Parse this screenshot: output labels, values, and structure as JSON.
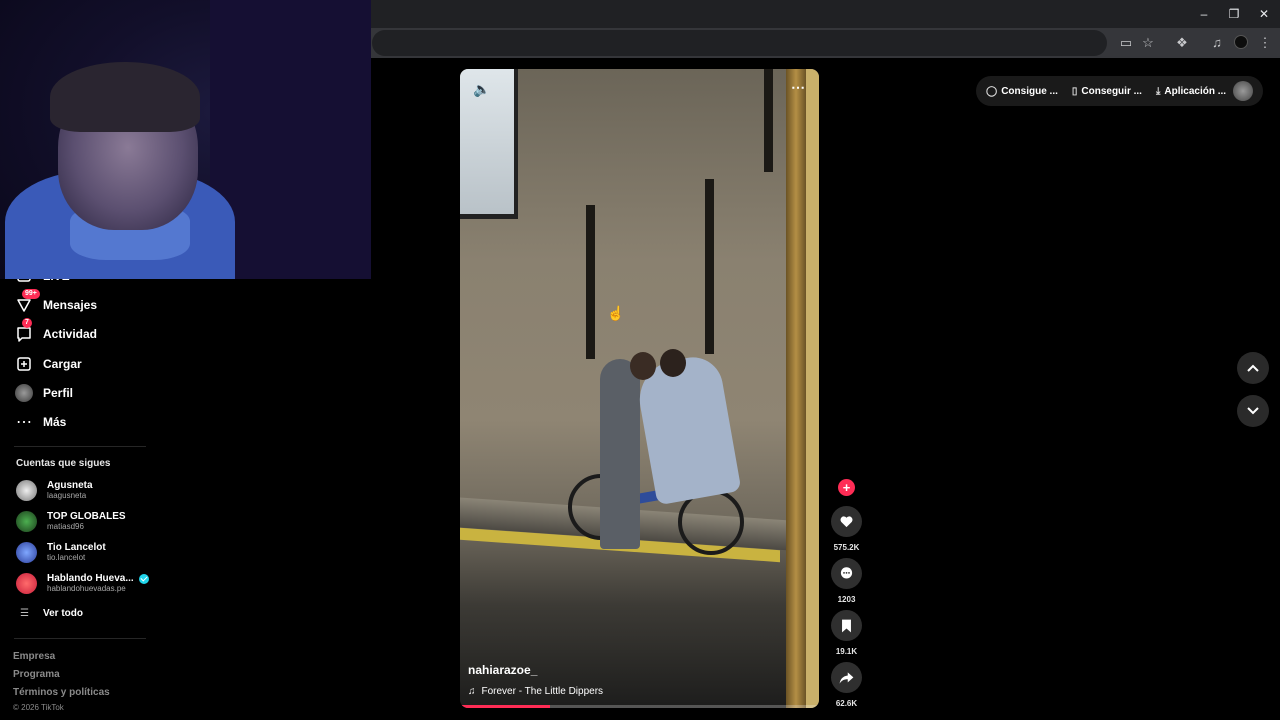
{
  "sidebar": {
    "nav": [
      {
        "label": "LIVE",
        "icon": "live-icon"
      },
      {
        "label": "Mensajes",
        "icon": "messages-icon",
        "badge": "99+"
      },
      {
        "label": "Actividad",
        "icon": "activity-icon",
        "badge": "7"
      },
      {
        "label": "Cargar",
        "icon": "upload-icon"
      },
      {
        "label": "Perfil",
        "icon": "profile-avatar"
      },
      {
        "label": "Más",
        "icon": "more-icon"
      }
    ],
    "following_title": "Cuentas que sigues",
    "accounts": [
      {
        "name": "Agusneta",
        "user": "laagusneta"
      },
      {
        "name": "TOP GLOBALES",
        "user": "matiasd96"
      },
      {
        "name": "Tio Lancelot",
        "user": "tio.lancelot"
      },
      {
        "name": "Hablando Hueva...",
        "user": "hablandohuevadas.pe",
        "verified": true
      }
    ],
    "see_all": "Ver todo",
    "footer": [
      "Empresa",
      "Programa",
      "Términos y políticas"
    ],
    "copyright": "© 2026 TikTok"
  },
  "video": {
    "author": "nahiarazoe_",
    "music": "Forever - The Little Dippers",
    "progress": 0.25
  },
  "actions": {
    "likes": "575.2K",
    "comments": "1203",
    "saves": "19.1K",
    "shares": "62.6K"
  },
  "top_bar": {
    "coins": "Consigue ...",
    "get_app": "Conseguir ...",
    "download": "Aplicación ..."
  },
  "colors": {
    "accent": "#fe2c55",
    "background": "#000000",
    "verified": "#20d5ec"
  }
}
